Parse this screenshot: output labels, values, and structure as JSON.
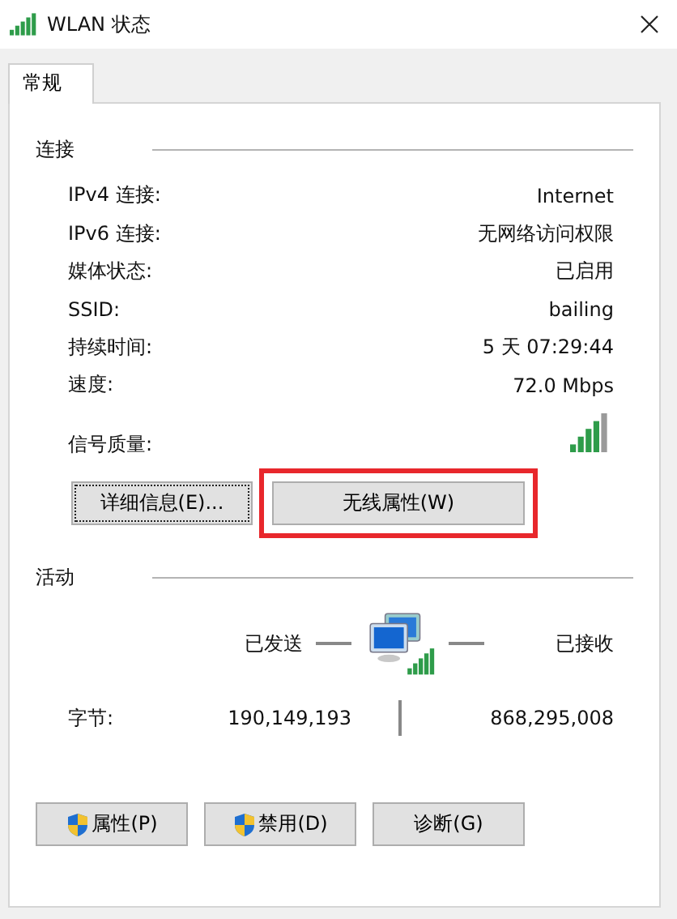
{
  "window": {
    "title": "WLAN 状态"
  },
  "tabs": [
    {
      "label": "常规",
      "selected": true
    }
  ],
  "connection": {
    "heading": "连接",
    "rows": [
      {
        "kind": "text",
        "label": "IPv4 连接:",
        "value": "Internet"
      },
      {
        "kind": "text",
        "label": "IPv6 连接:",
        "value": "无网络访问权限"
      },
      {
        "kind": "text",
        "label": "媒体状态:",
        "value": "已启用"
      },
      {
        "kind": "text",
        "label": "SSID:",
        "value": "bailing"
      },
      {
        "kind": "text",
        "label": "持续时间:",
        "value": "5 天 07:29:44"
      },
      {
        "kind": "text",
        "label": "速度:",
        "value": "72.0 Mbps"
      },
      {
        "kind": "signal",
        "label": "信号质量:"
      }
    ],
    "buttons": [
      {
        "label": "详细信息(E)...",
        "focused": true,
        "highlighted": false
      },
      {
        "label": "无线属性(W)",
        "focused": false,
        "highlighted": true
      }
    ]
  },
  "activity": {
    "heading": "活动",
    "sent_label": "已发送",
    "received_label": "已接收",
    "bytes_label": "字节:",
    "bytes_sent": "190,149,193",
    "bytes_received": "868,295,008"
  },
  "footer_buttons": [
    {
      "label": "属性(P)",
      "shield": true
    },
    {
      "label": "禁用(D)",
      "shield": true
    },
    {
      "label": "诊断(G)",
      "shield": false
    }
  ]
}
